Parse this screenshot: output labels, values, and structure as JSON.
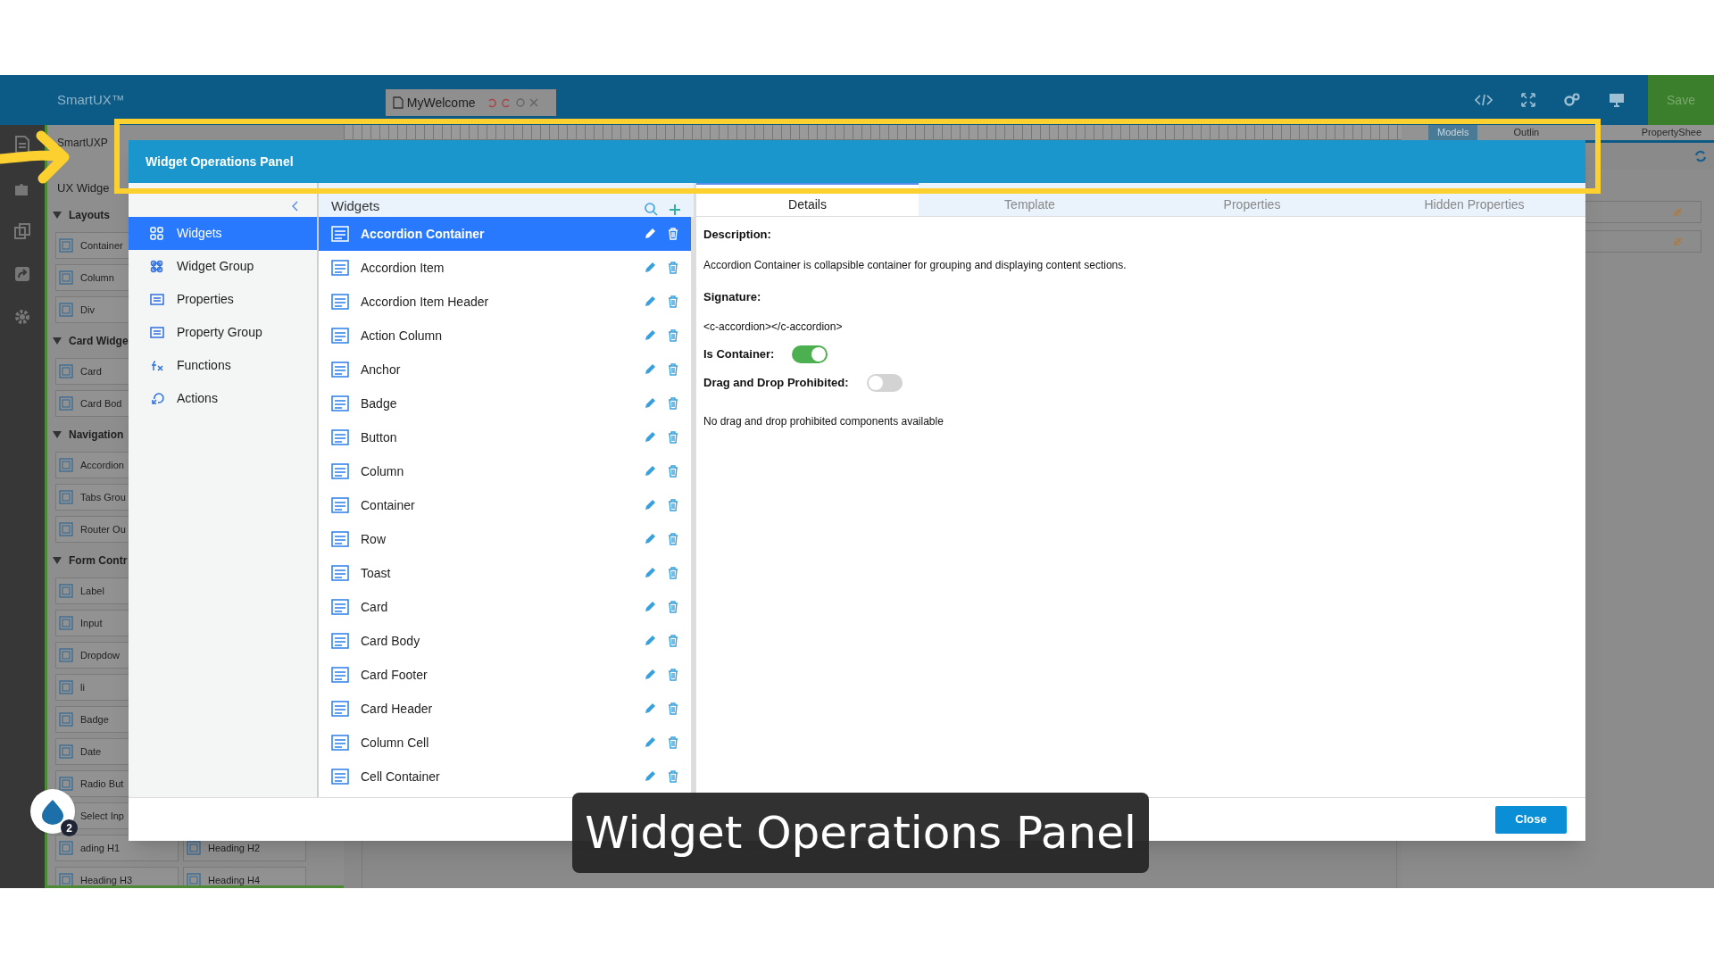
{
  "app": {
    "title": "SmartUX™",
    "document_tab": {
      "label": "MyWelcome"
    },
    "save_button": "Save"
  },
  "palette": {
    "project": "SmartUXP",
    "title": "UX Widge",
    "sections": [
      {
        "label": "Layouts",
        "expanded": true,
        "rows": [
          [
            "Container"
          ],
          [
            "Column"
          ],
          [
            "Div"
          ]
        ]
      },
      {
        "label": "Card Widge",
        "expanded": true,
        "rows": [
          [
            "Card"
          ],
          [
            "Card Bod"
          ]
        ]
      },
      {
        "label": "Navigation",
        "expanded": true,
        "rows": [
          [
            "Accordion"
          ],
          [
            "Tabs Grou"
          ],
          [
            "Router Ou"
          ]
        ]
      },
      {
        "label": "Form Contr",
        "expanded": true,
        "rows": [
          [
            "Label"
          ],
          [
            "Input"
          ],
          [
            "Dropdow"
          ],
          [
            "li"
          ],
          [
            "Badge"
          ],
          [
            "Date"
          ],
          [
            "Radio But"
          ],
          [
            "Select Inp"
          ],
          [
            "ading H1",
            "Heading H2"
          ],
          [
            "Heading H3",
            "Heading H4"
          ]
        ]
      }
    ]
  },
  "right_panel": {
    "tabs": [
      {
        "label": "Models",
        "selected": true
      },
      {
        "label": "Outlin",
        "selected": false
      },
      {
        "label": "PropertyShee",
        "selected": false
      }
    ]
  },
  "dialog": {
    "title": "Widget Operations Panel",
    "sidebar": [
      {
        "label": "Widgets",
        "selected": true
      },
      {
        "label": "Widget Group",
        "selected": false
      },
      {
        "label": "Properties",
        "selected": false
      },
      {
        "label": "Property Group",
        "selected": false
      },
      {
        "label": "Functions",
        "selected": false
      },
      {
        "label": "Actions",
        "selected": false
      }
    ],
    "widgets": {
      "title": "Widgets",
      "items": [
        {
          "label": "Accordion Container",
          "selected": true
        },
        {
          "label": "Accordion Item",
          "selected": false
        },
        {
          "label": "Accordion Item Header",
          "selected": false
        },
        {
          "label": "Action Column",
          "selected": false
        },
        {
          "label": "Anchor",
          "selected": false
        },
        {
          "label": "Badge",
          "selected": false
        },
        {
          "label": "Button",
          "selected": false
        },
        {
          "label": "Column",
          "selected": false
        },
        {
          "label": "Container",
          "selected": false
        },
        {
          "label": "Row",
          "selected": false
        },
        {
          "label": "Toast",
          "selected": false
        },
        {
          "label": "Card",
          "selected": false
        },
        {
          "label": "Card Body",
          "selected": false
        },
        {
          "label": "Card Footer",
          "selected": false
        },
        {
          "label": "Card Header",
          "selected": false
        },
        {
          "label": "Column Cell",
          "selected": false
        },
        {
          "label": "Cell Container",
          "selected": false
        }
      ]
    },
    "tabs": [
      {
        "label": "Details",
        "selected": true
      },
      {
        "label": "Template",
        "selected": false
      },
      {
        "label": "Properties",
        "selected": false
      },
      {
        "label": "Hidden Properties",
        "selected": false
      }
    ],
    "details": {
      "description_label": "Description:",
      "description": "Accordion Container is collapsible container for grouping and displaying content sections.",
      "signature_label": "Signature:",
      "signature": "<c-accordion></c-accordion>",
      "toggles": [
        {
          "label": "Is Container:",
          "on": true
        },
        {
          "label": "Drag and Drop Prohibited:",
          "on": false
        }
      ],
      "message": "No drag and drop prohibited components available"
    },
    "close_button": "Close"
  },
  "caption": "Widget Operations Panel",
  "notification_count": "2"
}
